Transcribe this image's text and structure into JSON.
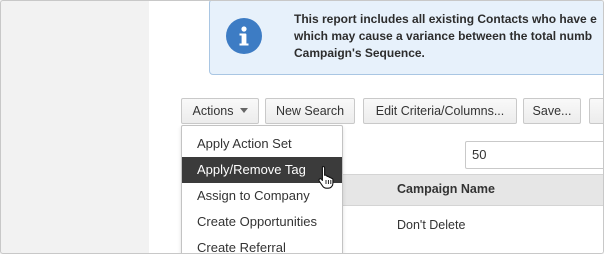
{
  "banner": {
    "lines": [
      "This report includes all existing Contacts who have e",
      "which may cause a variance between the total numb",
      "Campaign's Sequence."
    ]
  },
  "toolbar": {
    "actions_label": "Actions",
    "new_search_label": "New Search",
    "edit_criteria_label": "Edit Criteria/Columns...",
    "save_label": "Save..."
  },
  "page_size": {
    "value": "50"
  },
  "table": {
    "columns": [
      "Campaign Name"
    ],
    "rows": [
      [
        "Don't Delete"
      ]
    ]
  },
  "actions_menu": {
    "items": [
      {
        "label": "Apply Action Set"
      },
      {
        "label": "Apply/Remove Tag"
      },
      {
        "label": "Assign to Company"
      },
      {
        "label": "Create Opportunities"
      },
      {
        "label": "Create Referral"
      }
    ],
    "highlighted": "Apply/Remove Tag"
  },
  "colors": {
    "banner_bg": "#e7f1fb",
    "info_icon": "#3d7cc4",
    "menu_highlight": "#3b3b3b"
  },
  "icons": [
    "info-icon",
    "caret-down-icon",
    "hand-pointer-cursor-icon"
  ]
}
